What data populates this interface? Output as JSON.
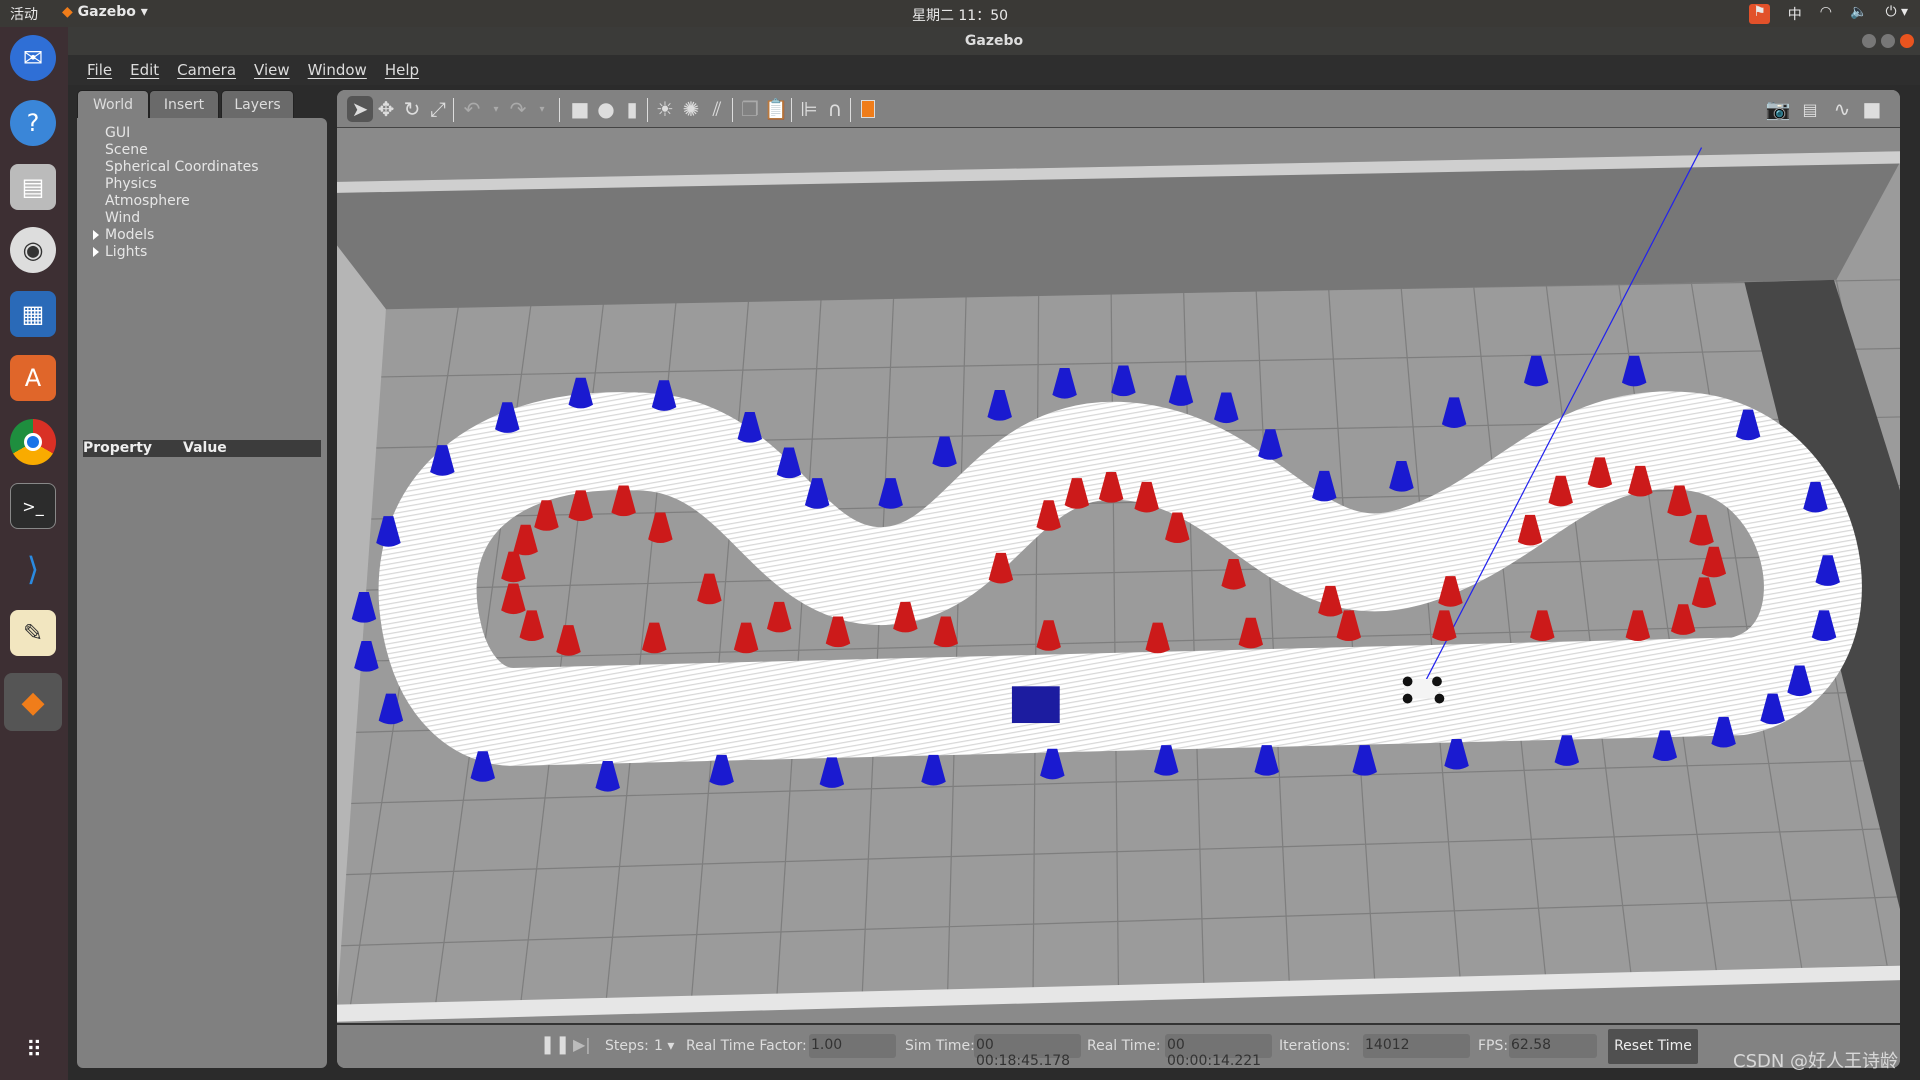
{
  "topbar": {
    "activities": "活动",
    "app_menu": "Gazebo",
    "clock": "星期二 11：50",
    "input_method": "中"
  },
  "window": {
    "title": "Gazebo"
  },
  "menu": [
    "File",
    "Edit",
    "Camera",
    "View",
    "Window",
    "Help"
  ],
  "left_panel": {
    "tabs": [
      "World",
      "Insert",
      "Layers"
    ],
    "active_tab": "World",
    "tree": [
      {
        "label": "GUI"
      },
      {
        "label": "Scene"
      },
      {
        "label": "Spherical Coordinates"
      },
      {
        "label": "Physics"
      },
      {
        "label": "Atmosphere"
      },
      {
        "label": "Wind"
      },
      {
        "label": "Models",
        "expandable": true
      },
      {
        "label": "Lights",
        "expandable": true
      }
    ],
    "property_header": {
      "property": "Property",
      "value": "Value"
    }
  },
  "toolbar": {
    "tools": [
      "select-arrow-icon",
      "translate-icon",
      "rotate-icon",
      "scale-icon",
      "undo-icon",
      "redo-icon",
      "box-icon",
      "sphere-icon",
      "cylinder-icon",
      "point-light-icon",
      "spot-light-icon",
      "directional-light-icon",
      "copy-icon",
      "paste-icon",
      "align-icon",
      "snap-icon",
      "view-angle-icon"
    ],
    "right_tools": [
      "screenshot-icon",
      "log-icon",
      "plot-icon",
      "record-video-icon"
    ],
    "accent": "#f07d1a"
  },
  "scene": {
    "colors": {
      "floor": "#9b9b9b",
      "track": "#ffffff",
      "outer_cones": "#1a1ad0",
      "inner_cones": "#cc1a1a",
      "box": "#1c1ca0"
    }
  },
  "status": {
    "steps_label": "Steps:",
    "steps_value": "1",
    "rtf_label": "Real Time Factor:",
    "rtf_value": "1.00",
    "sim_label": "Sim Time:",
    "sim_value": "00 00:18:45.178",
    "real_label": "Real Time:",
    "real_value": "00 00:00:14.221",
    "iter_label": "Iterations:",
    "iter_value": "14012",
    "fps_label": "FPS:",
    "fps_value": "62.58",
    "reset_label": "Reset Time"
  },
  "watermark": "CSDN @好人王诗龄"
}
